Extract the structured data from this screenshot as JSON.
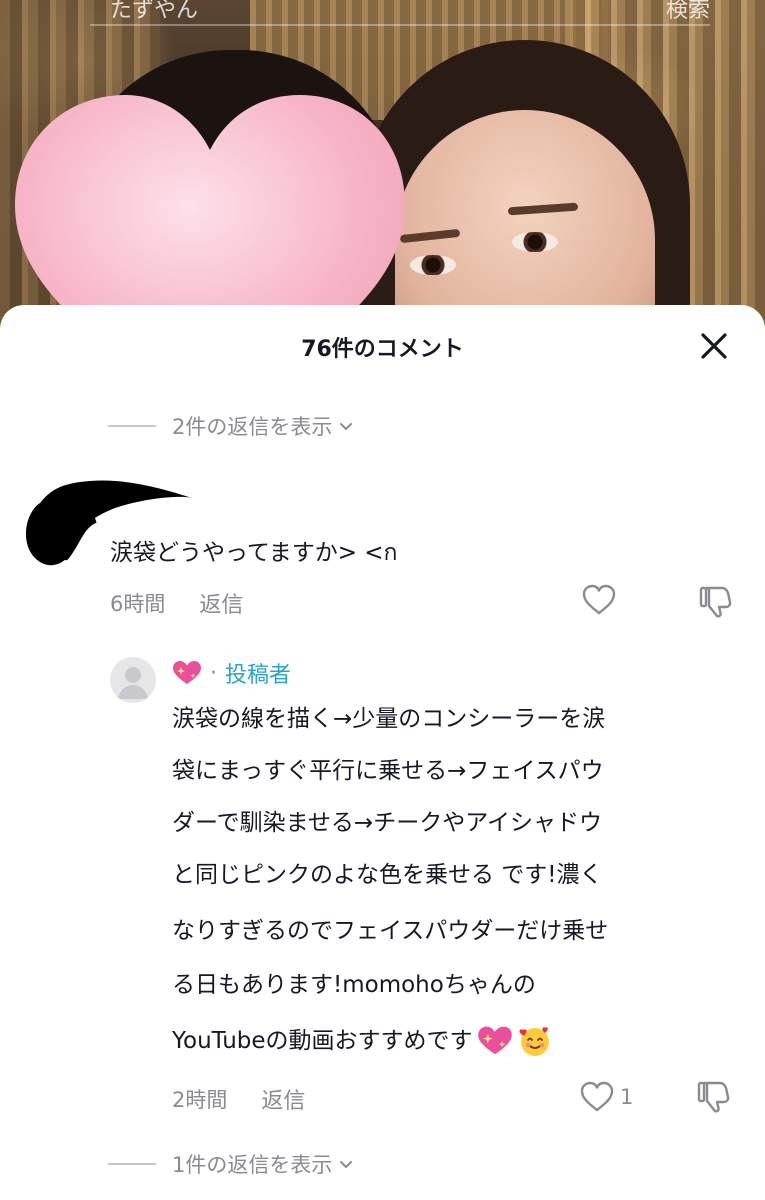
{
  "background": {
    "search_left": "たずやん",
    "search_right": "検索"
  },
  "sheet": {
    "title": "76件のコメント",
    "close_icon": "close-icon"
  },
  "replies_top": {
    "label": "2件の返信を表示"
  },
  "comment": {
    "text": "涙袋どうやってますか> <ก",
    "time": "6時間",
    "reply_label": "返信",
    "like_icon": "heart-outline-icon",
    "dislike_icon": "thumbs-down-icon"
  },
  "reply": {
    "author_emoji": "sparkling-heart-emoji",
    "separator": "·",
    "author_tag": "投稿者",
    "lines": [
      "涙袋の線を描く→少量のコンシーラーを涙",
      "袋にまっすぐ平行に乗せる→フェイスパウ",
      "ダーで馴染ませる→チークやアイシャドウ",
      "と同じピンクのよな色を乗せる です!濃く",
      "なりすぎるのでフェイスパウダーだけ乗せ",
      "る日もあります!momohoちゃんの",
      "YouTubeの動画おすすめです"
    ],
    "time": "2時間",
    "reply_label": "返信",
    "like_count": "1",
    "like_icon": "heart-outline-icon",
    "dislike_icon": "thumbs-down-icon"
  },
  "replies_bottom": {
    "label": "1件の返信を表示"
  },
  "colors": {
    "text_primary": "#161823",
    "text_secondary": "#8a8b91",
    "author_tag": "#2aa3c7",
    "heart_sticker": "#f7b6c8"
  }
}
